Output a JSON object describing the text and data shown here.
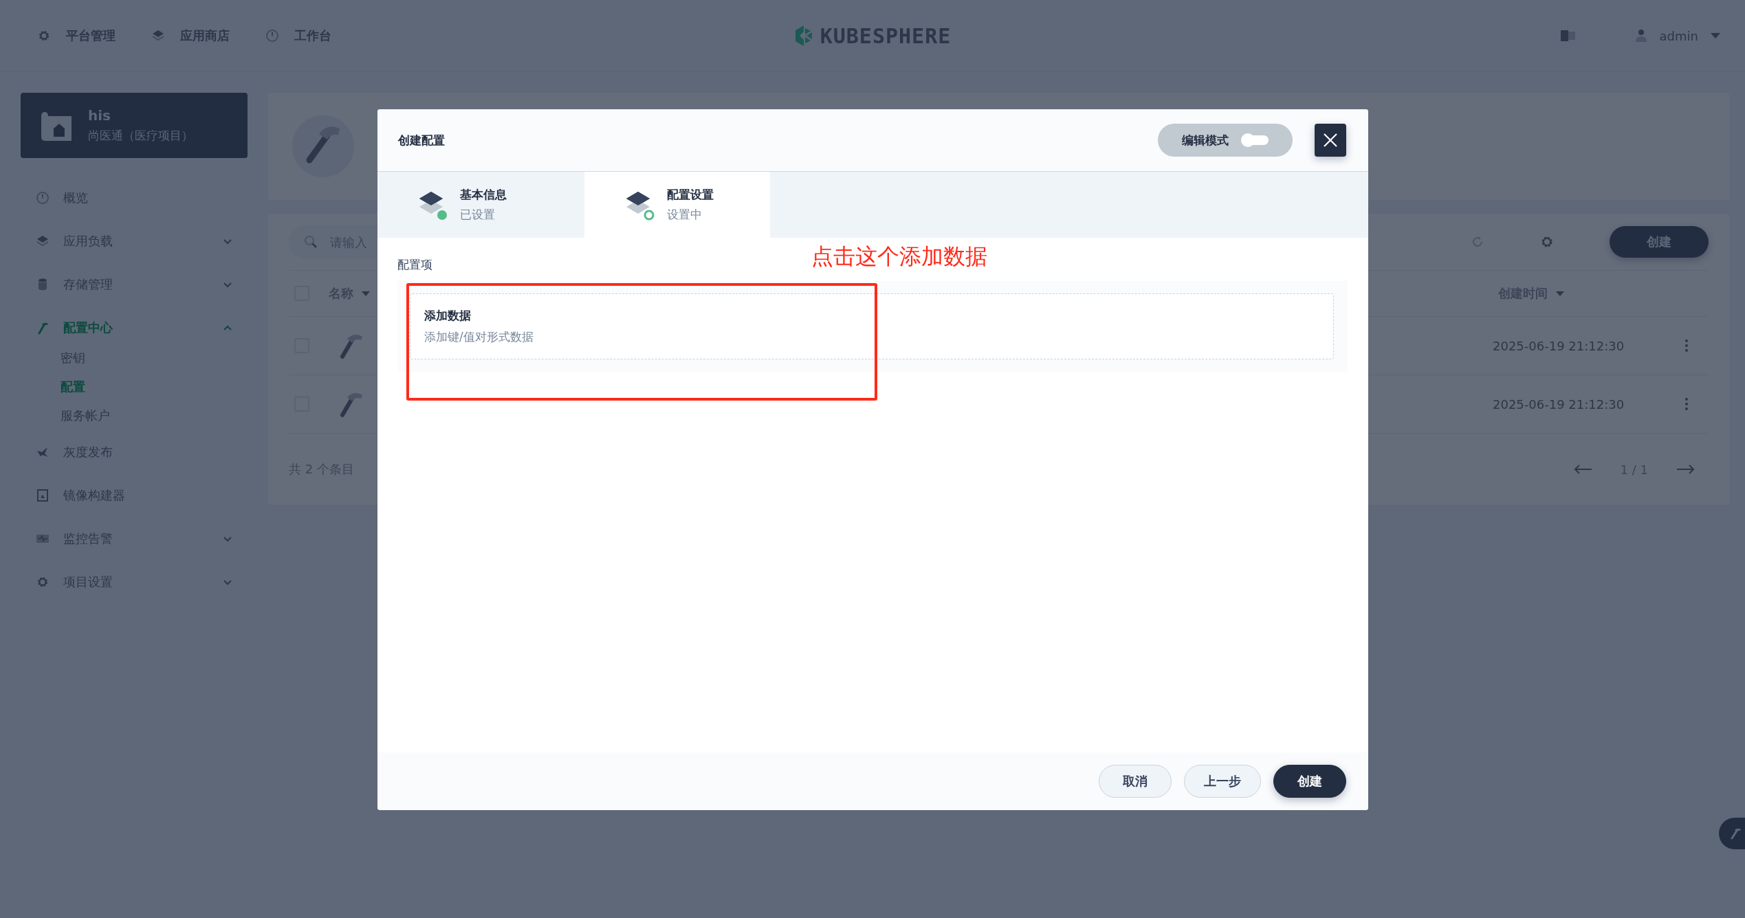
{
  "top_nav": {
    "items": [
      {
        "label": "平台管理"
      },
      {
        "label": "应用商店"
      },
      {
        "label": "工作台"
      }
    ],
    "logo": "KUBESPHERE",
    "user": "admin"
  },
  "project": {
    "name": "his",
    "description": "尚医通（医疗项目）"
  },
  "sidebar": {
    "items": [
      {
        "label": "概览",
        "selected": false
      },
      {
        "label": "应用负载",
        "selected": false,
        "expanded": false
      },
      {
        "label": "存储管理",
        "selected": false,
        "expanded": false
      },
      {
        "label": "配置中心",
        "selected": true,
        "expanded": true,
        "children": [
          {
            "label": "密钥",
            "selected": false
          },
          {
            "label": "配置",
            "selected": true
          },
          {
            "label": "服务帐户",
            "selected": false
          }
        ]
      },
      {
        "label": "灰度发布",
        "selected": false
      },
      {
        "label": "镜像构建器",
        "selected": false
      },
      {
        "label": "监控告警",
        "selected": false,
        "expanded": false
      },
      {
        "label": "项目设置",
        "selected": false,
        "expanded": false
      }
    ]
  },
  "toolbar": {
    "search_placeholder": "请输入",
    "create_button": "创建"
  },
  "table": {
    "columns": [
      "名称",
      "创建时间"
    ],
    "header_checked": false,
    "rows": [
      {
        "checked": false,
        "created": "2025-06-19 21:12:30"
      },
      {
        "checked": false,
        "created": "2025-06-19 21:12:30"
      }
    ],
    "total": "共 2 个条目",
    "pagination": "1 / 1"
  },
  "modal": {
    "title": "创建配置",
    "edit_mode": {
      "label": "编辑模式",
      "on": false
    },
    "steps": [
      {
        "title": "基本信息",
        "status": "已设置",
        "selected": false,
        "done": true
      },
      {
        "title": "配置设置",
        "status": "设置中",
        "selected": true,
        "done": false
      }
    ],
    "section_label": "配置项",
    "add_data": {
      "title": "添加数据",
      "description": "添加键/值对形式数据"
    },
    "buttons": [
      {
        "label": "取消",
        "kind": "secondary"
      },
      {
        "label": "上一步",
        "kind": "secondary"
      },
      {
        "label": "创建",
        "kind": "primary"
      }
    ]
  },
  "annotation": {
    "text": "点击这个添加数据"
  }
}
